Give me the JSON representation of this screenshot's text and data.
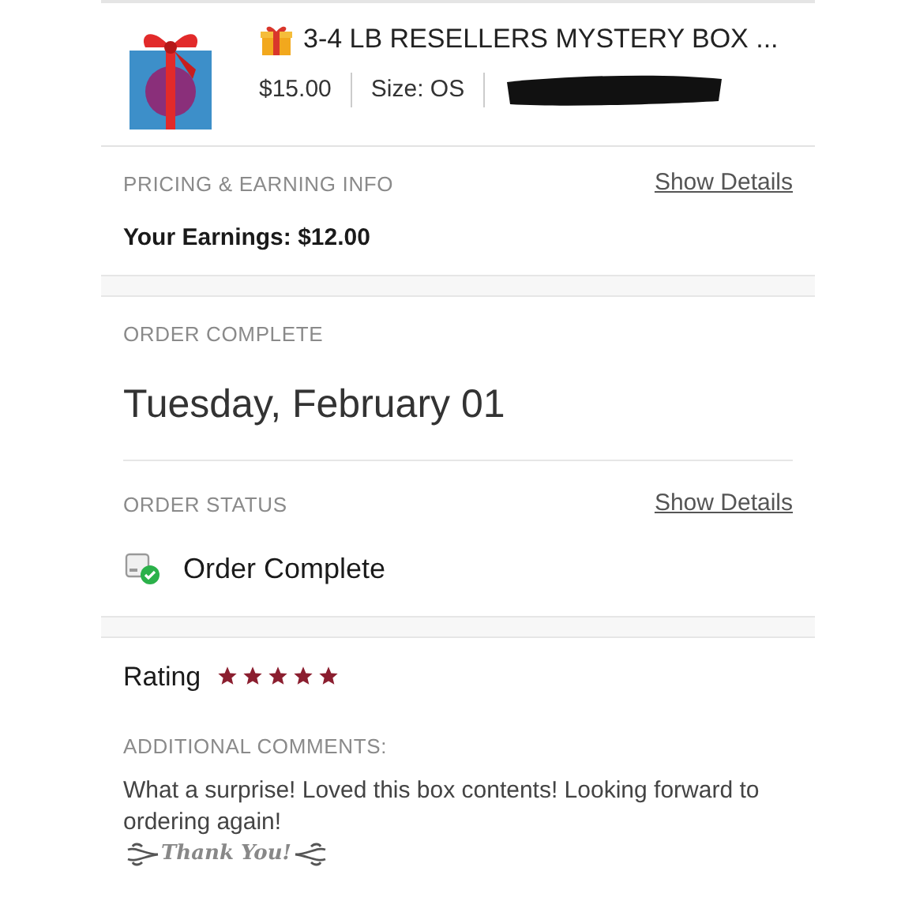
{
  "product": {
    "title": "3-4 LB RESELLERS MYSTERY BOX ...",
    "price": "$15.00",
    "size": "Size: OS",
    "redacted": true
  },
  "pricing": {
    "heading": "PRICING & EARNING INFO",
    "link": "Show Details",
    "earnings": "Your Earnings: $12.00"
  },
  "completion": {
    "heading": "ORDER COMPLETE",
    "date": "Tuesday, February 01"
  },
  "status": {
    "heading": "ORDER STATUS",
    "link": "Show Details",
    "value": "Order Complete",
    "complete": true
  },
  "rating": {
    "label": "Rating",
    "stars": 5
  },
  "comments": {
    "heading": "ADDITIONAL COMMENTS:",
    "text": "What a surprise! Loved this box contents! Looking forward to ordering again!",
    "signoff": "Thank You!"
  }
}
